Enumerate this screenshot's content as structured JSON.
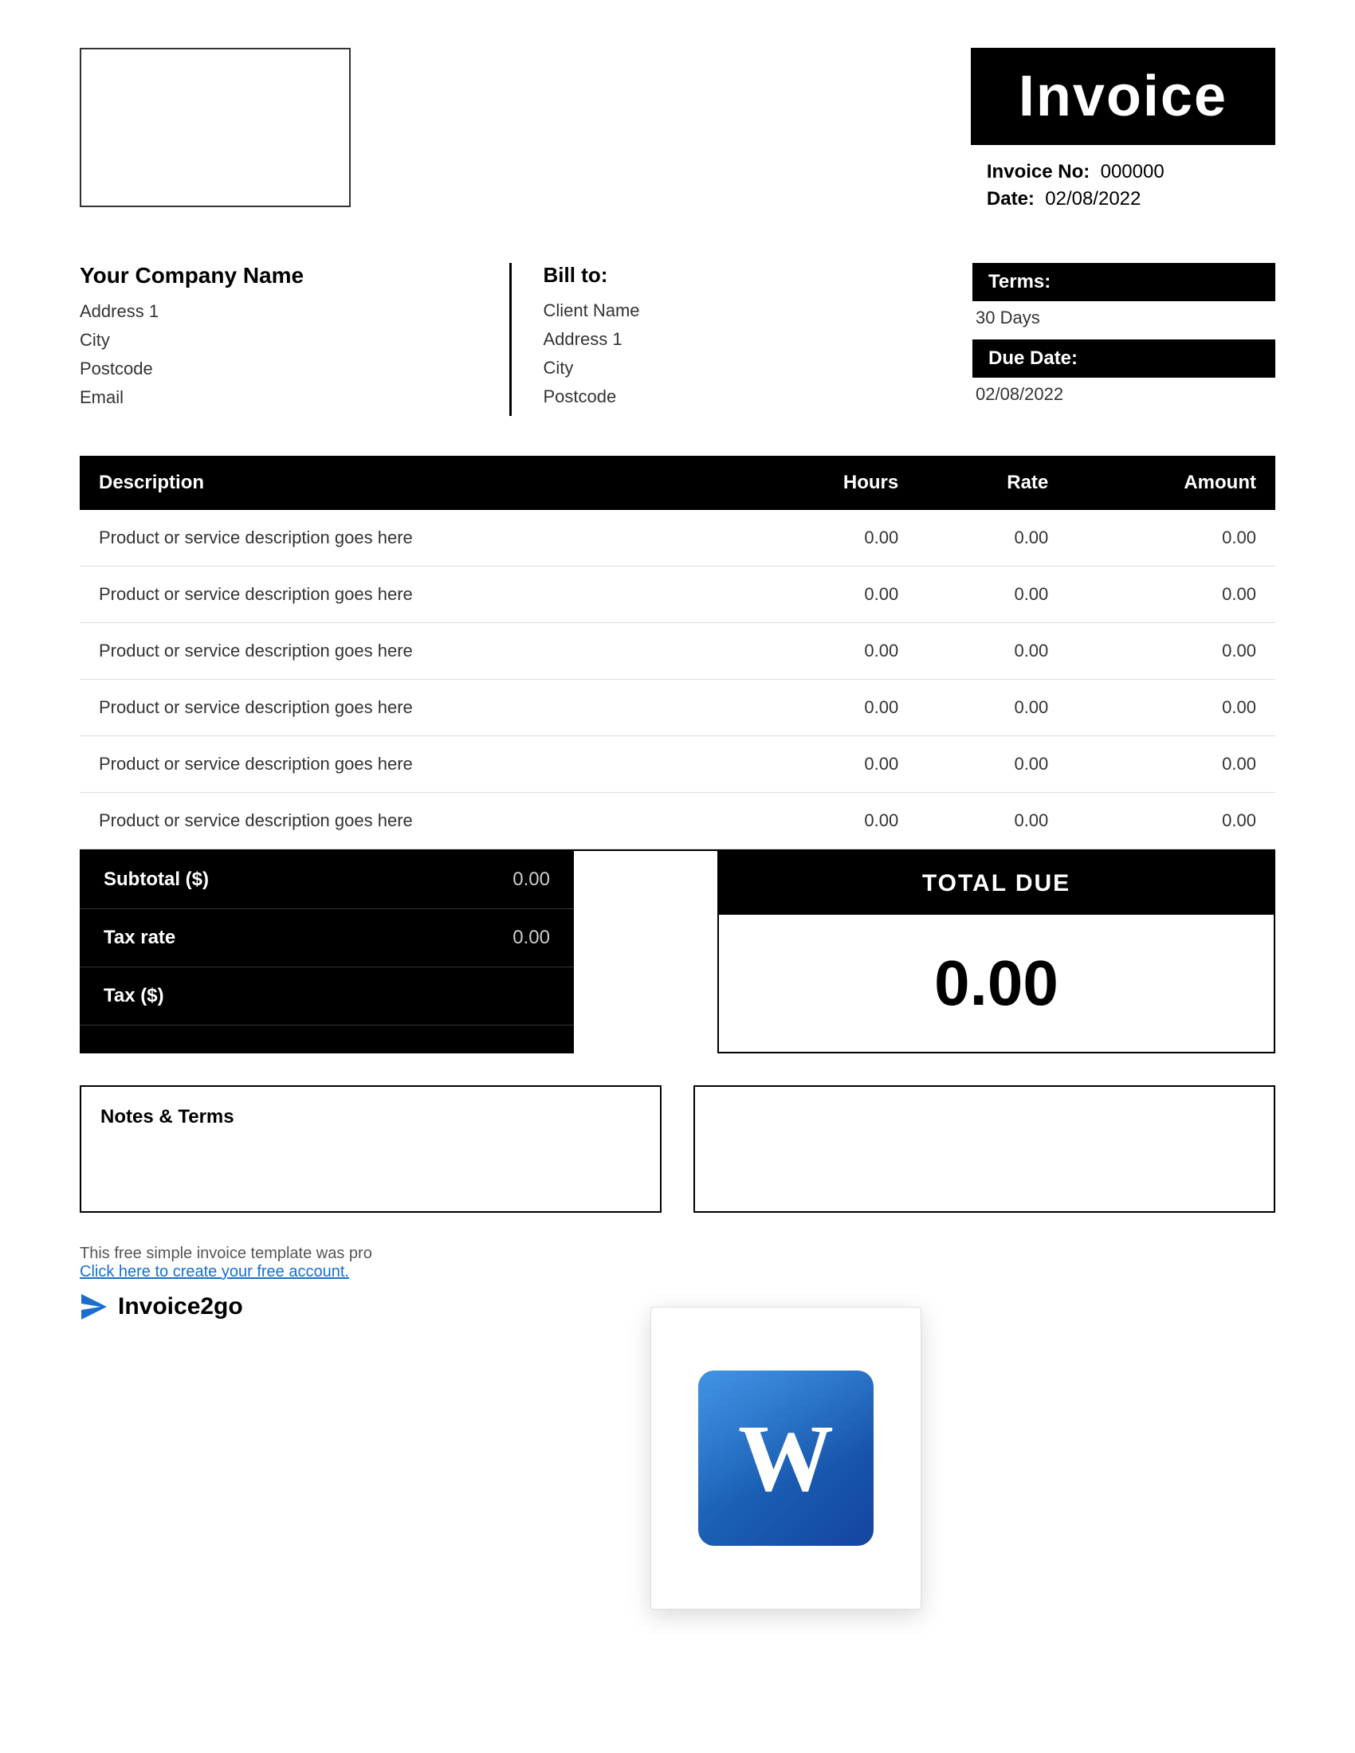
{
  "header": {
    "invoice_title": "Invoice",
    "invoice_no_label": "Invoice No:",
    "invoice_no_value": "000000",
    "date_label": "Date:",
    "date_value": "02/08/2022"
  },
  "from": {
    "company_name": "Your Company Name",
    "address1": "Address 1",
    "city": "City",
    "postcode": "Postcode",
    "email": "Email"
  },
  "bill_to": {
    "label": "Bill to:",
    "client_name": "Client Name",
    "address1": "Address 1",
    "city": "City",
    "postcode": "Postcode"
  },
  "terms": {
    "terms_label": "Terms:",
    "terms_value": "30 Days",
    "due_date_label": "Due Date:",
    "due_date_value": "02/08/2022"
  },
  "table": {
    "headers": {
      "description": "Description",
      "hours": "Hours",
      "rate": "Rate",
      "amount": "Amount"
    },
    "rows": [
      {
        "description": "Product or service description goes here",
        "hours": "0.00",
        "rate": "0.00",
        "amount": "0.00"
      },
      {
        "description": "Product or service description goes here",
        "hours": "0.00",
        "rate": "0.00",
        "amount": "0.00"
      },
      {
        "description": "Product or service description goes here",
        "hours": "0.00",
        "rate": "0.00",
        "amount": "0.00"
      },
      {
        "description": "Product or service description goes here",
        "hours": "0.00",
        "rate": "0.00",
        "amount": "0.00"
      },
      {
        "description": "Product or service description goes here",
        "hours": "0.00",
        "rate": "0.00",
        "amount": "0.00"
      },
      {
        "description": "Product or service description goes here",
        "hours": "0.00",
        "rate": "0.00",
        "amount": "0.00"
      }
    ]
  },
  "totals": {
    "subtotal_label": "Subtotal ($)",
    "subtotal_value": "0.00",
    "tax_rate_label": "Tax rate",
    "tax_rate_value": "0.00",
    "tax_label": "Tax ($)",
    "tax_value": "",
    "total_due_label": "TOTAL DUE",
    "total_due_value": "0.00"
  },
  "notes": {
    "notes_terms_label": "Notes & Terms",
    "notes_content": ""
  },
  "footer": {
    "promo_text": "This free simple invoice template was pro",
    "link_text": "Click here to create your free account.",
    "brand_name": "Invoice2go"
  }
}
